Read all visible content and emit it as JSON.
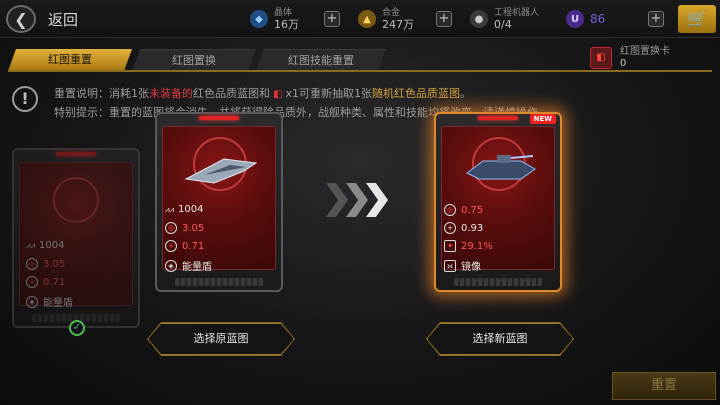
{
  "header": {
    "back_label": "返回",
    "resources": [
      {
        "name": "crystal",
        "label": "晶体",
        "value": "16万",
        "icon": "crystal-icon",
        "color": "#3a8ad8"
      },
      {
        "name": "alloy",
        "label": "合金",
        "value": "247万",
        "icon": "alloy-icon",
        "color": "#d8a82a"
      },
      {
        "name": "robot",
        "label": "工程机器人",
        "value": "0/4",
        "icon": "robot-icon",
        "color": "#8a8a8a"
      },
      {
        "name": "premium",
        "label": "",
        "value": "86",
        "icon": "u-coin-icon",
        "color": "#7a4ad0"
      }
    ]
  },
  "tabs": [
    {
      "label": "红图重置",
      "active": true
    },
    {
      "label": "红图置换",
      "active": false
    },
    {
      "label": "红图技能重置",
      "active": false
    }
  ],
  "reset_card": {
    "label": "红图置换卡",
    "count": "0"
  },
  "notice": {
    "line1_prefix": "重置说明：消耗1张",
    "line1_red": "未装备的",
    "line1_mid": "红色品质蓝图和",
    "line1_cost": "x1可重新抽取1张",
    "line1_gold": "随机红色品质蓝图",
    "line1_end": "。",
    "line2": "特别提示：重置的蓝图将会消失，并将获得除品质外，战舰种类、属性和技能均将改变。请谨慎操作。"
  },
  "cards": {
    "left_dim": {
      "power": "1004",
      "stat1": "3.05",
      "stat2": "0.71",
      "skill": "能量盾"
    },
    "original": {
      "power": "1004",
      "stat1": "3.05",
      "stat2": "0.71",
      "skill": "能量盾"
    },
    "new": {
      "badge": "NEW",
      "stat1": "0.75",
      "stat2": "0.93",
      "stat3": "29.1%",
      "skill": "镜像"
    }
  },
  "buttons": {
    "select_original": "选择原蓝图",
    "select_new": "选择新蓝图",
    "reset": "重置"
  }
}
